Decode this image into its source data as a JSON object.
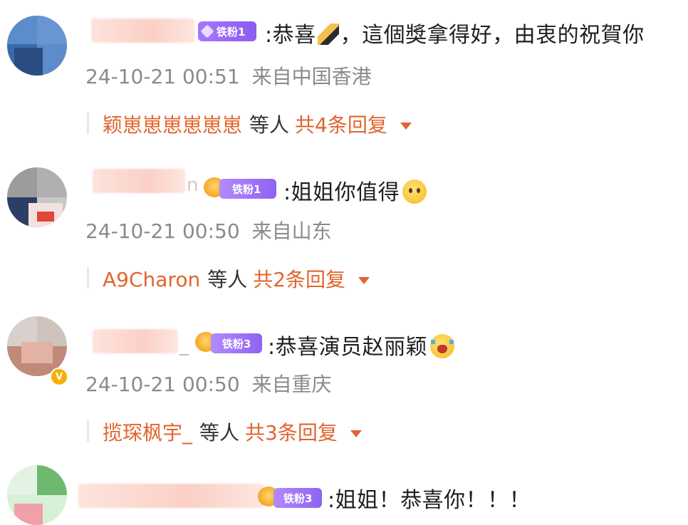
{
  "comments": [
    {
      "name_suffix": "",
      "badge": "铁粉1",
      "text": ":恭喜",
      "text_after_pen": "，這個獎拿得好，由衷的祝賀你",
      "emoji": "pencil-icon",
      "time": "24-10-21 00:51",
      "location": "来自中国香港",
      "reply_user": "颖崽崽崽崽崽崽",
      "reply_etc": "等人",
      "reply_count": "共4条回复"
    },
    {
      "name_suffix": "n",
      "badge": "铁粉1",
      "text": ":姐姐你值得",
      "emoji": "sad-face-icon",
      "time": "24-10-21 00:50",
      "location": "来自山东",
      "reply_user": "A9Charon",
      "reply_etc": "等人",
      "reply_count": "共2条回复"
    },
    {
      "name_suffix": "_",
      "badge": "铁粉3",
      "text": ":恭喜演员赵丽颖",
      "emoji": "crying-face-icon",
      "time": "24-10-21 00:50",
      "location": "来自重庆",
      "reply_user": "揽琛枫宇_",
      "reply_etc": "等人",
      "reply_count": "共3条回复"
    },
    {
      "name_suffix": "",
      "badge": "铁粉3",
      "text": ":姐姐！恭喜你！！！"
    }
  ],
  "colors": {
    "accent": "#e2642e",
    "meta": "#8a8a8a",
    "badge": "#9b6bfa"
  }
}
